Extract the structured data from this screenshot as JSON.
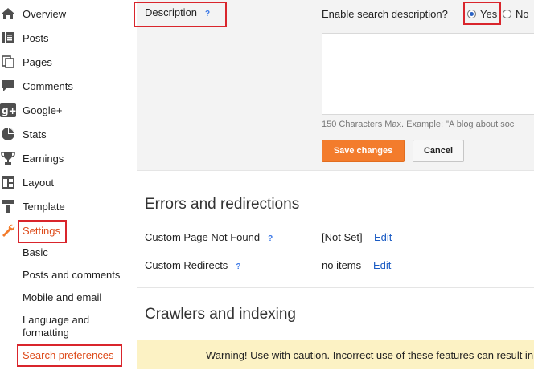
{
  "sidebar": {
    "items": [
      {
        "label": "Overview",
        "icon": "home-icon"
      },
      {
        "label": "Posts",
        "icon": "posts-icon"
      },
      {
        "label": "Pages",
        "icon": "pages-icon"
      },
      {
        "label": "Comments",
        "icon": "comment-icon"
      },
      {
        "label": "Google+",
        "icon": "google-plus-icon"
      },
      {
        "label": "Stats",
        "icon": "pie-chart-icon"
      },
      {
        "label": "Earnings",
        "icon": "trophy-icon"
      },
      {
        "label": "Layout",
        "icon": "layout-icon"
      },
      {
        "label": "Template",
        "icon": "template-icon"
      },
      {
        "label": "Settings",
        "icon": "wrench-icon"
      }
    ],
    "subitems": [
      "Basic",
      "Posts and comments",
      "Mobile and email",
      "Language and formatting",
      "Search preferences"
    ]
  },
  "description": {
    "label": "Description",
    "help": "?",
    "enable_label": "Enable search description?",
    "yes_label": "Yes",
    "no_label": "No",
    "selected": "Yes",
    "textarea_value": "",
    "hint": "150 Characters Max. Example: \"A blog about soc",
    "save_label": "Save changes",
    "cancel_label": "Cancel"
  },
  "errors": {
    "title": "Errors and redirections",
    "rows": [
      {
        "label": "Custom Page Not Found",
        "help": "?",
        "value": "[Not Set]",
        "edit": "Edit"
      },
      {
        "label": "Custom Redirects",
        "help": "?",
        "value": "no items",
        "edit": "Edit"
      }
    ]
  },
  "crawlers": {
    "title": "Crawlers and indexing"
  },
  "warning": {
    "text": "Warning! Use with caution. Incorrect use of these features can result in"
  },
  "colors": {
    "accent": "#f37c2c",
    "highlight_box": "#d9252c",
    "settings_text": "#dd4b1b",
    "link": "#1a5bc4",
    "warning_bg": "#fcf2c4"
  }
}
